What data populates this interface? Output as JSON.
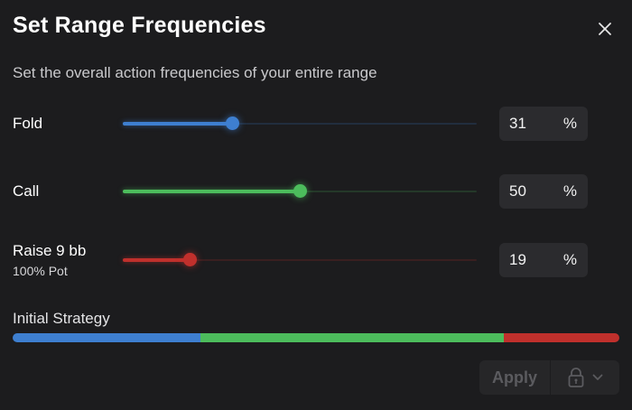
{
  "dialog": {
    "title": "Set Range Frequencies",
    "subtitle": "Set the overall action frequencies of your entire range"
  },
  "actions": [
    {
      "label": "Fold",
      "sublabel": "",
      "value": 31,
      "unit": "%",
      "color": "#3e7fd0"
    },
    {
      "label": "Call",
      "sublabel": "",
      "value": 50,
      "unit": "%",
      "color": "#4cbc5c"
    },
    {
      "label": "Raise 9 bb",
      "sublabel": "100% Pot",
      "value": 19,
      "unit": "%",
      "color": "#c0302c"
    }
  ],
  "initial_strategy": {
    "label": "Initial Strategy",
    "segments": [
      {
        "name": "Fold",
        "value": 31,
        "color": "#3e7fd0"
      },
      {
        "name": "Call",
        "value": 50,
        "color": "#4cbc5c"
      },
      {
        "name": "Raise 9 bb",
        "value": 19,
        "color": "#c0302c"
      }
    ]
  },
  "footer": {
    "apply_label": "Apply",
    "lock_icon": "lock-icon",
    "chevron_icon": "chevron-down-icon"
  }
}
